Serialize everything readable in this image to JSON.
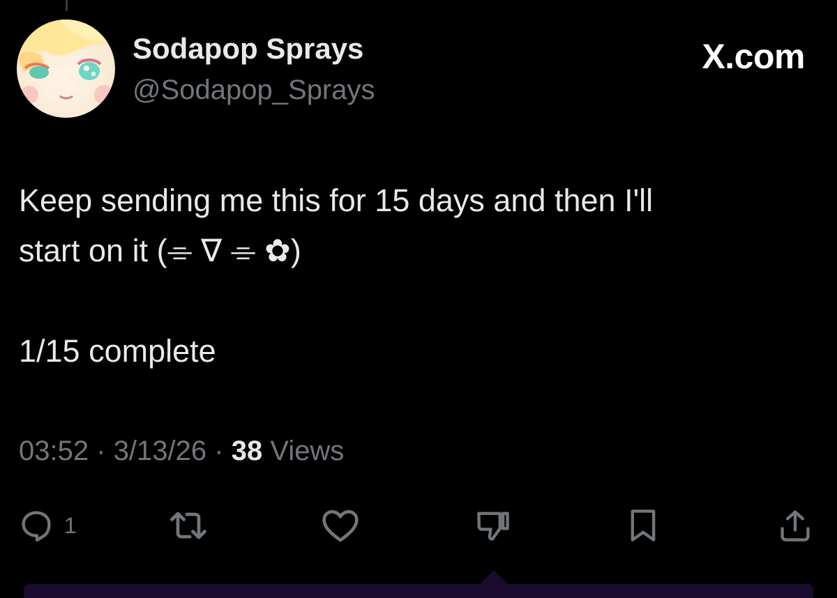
{
  "author": {
    "display_name": "Sodapop Sprays",
    "handle": "@Sodapop_Sprays",
    "avatar_icon": "avatar-illustration"
  },
  "brand": {
    "label": "X.com"
  },
  "tweet": {
    "text": "Keep sending me this for 15 days and then I'll\nstart on it  (⌯ ∇ ⌯ ✿)\n\n1/15 complete",
    "time": "03:52",
    "date": "3/13/26",
    "separator": "·",
    "views_count": "38",
    "views_label": "Views"
  },
  "actions": {
    "reply_count": "1",
    "icons": [
      "reply-icon",
      "retweet-icon",
      "like-icon",
      "dislike-icon",
      "bookmark-icon",
      "share-icon"
    ]
  },
  "colors": {
    "background": "#000000",
    "primary_text": "#e7e9ea",
    "secondary_text": "#71767b",
    "accent_bar": "#1a0b2e"
  }
}
